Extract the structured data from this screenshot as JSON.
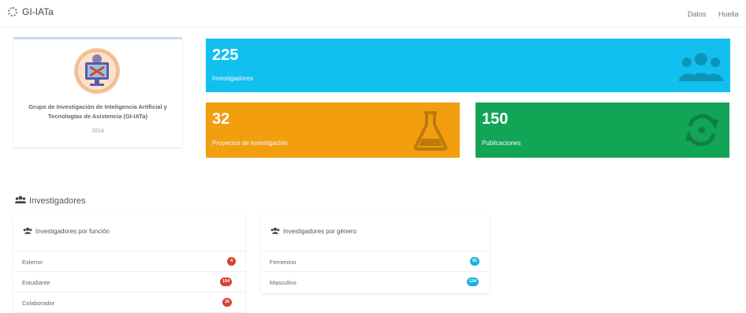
{
  "navbar": {
    "brand": "GI-IATa",
    "links": [
      "Datos",
      "Huella"
    ]
  },
  "group": {
    "name": "Grupo de Investigación de Inteligencia Artificial y Tecnologías de Asistencia (GI-IATa)",
    "year": "2014"
  },
  "stats": {
    "investigadores": {
      "value": "225",
      "label": "Investigadores",
      "icon": "users-icon",
      "color": "#11c0ee"
    },
    "proyectos": {
      "value": "32",
      "label": "Proyectos de Investigación",
      "icon": "flask-icon",
      "color": "#f29e0f"
    },
    "publicaciones": {
      "value": "150",
      "label": "Publicaciones",
      "icon": "refresh-icon",
      "color": "#12a556"
    }
  },
  "section": {
    "title": "Investigadores"
  },
  "por_funcion": {
    "title": "Investigadores por función",
    "items": [
      {
        "label": "Externo",
        "count": "4"
      },
      {
        "label": "Estudiante",
        "count": "194"
      },
      {
        "label": "Colaborador",
        "count": "26"
      }
    ]
  },
  "por_genero": {
    "title": "Investigadores por género",
    "items": [
      {
        "label": "Femenino",
        "count": "91"
      },
      {
        "label": "Masculino",
        "count": "134"
      }
    ]
  }
}
